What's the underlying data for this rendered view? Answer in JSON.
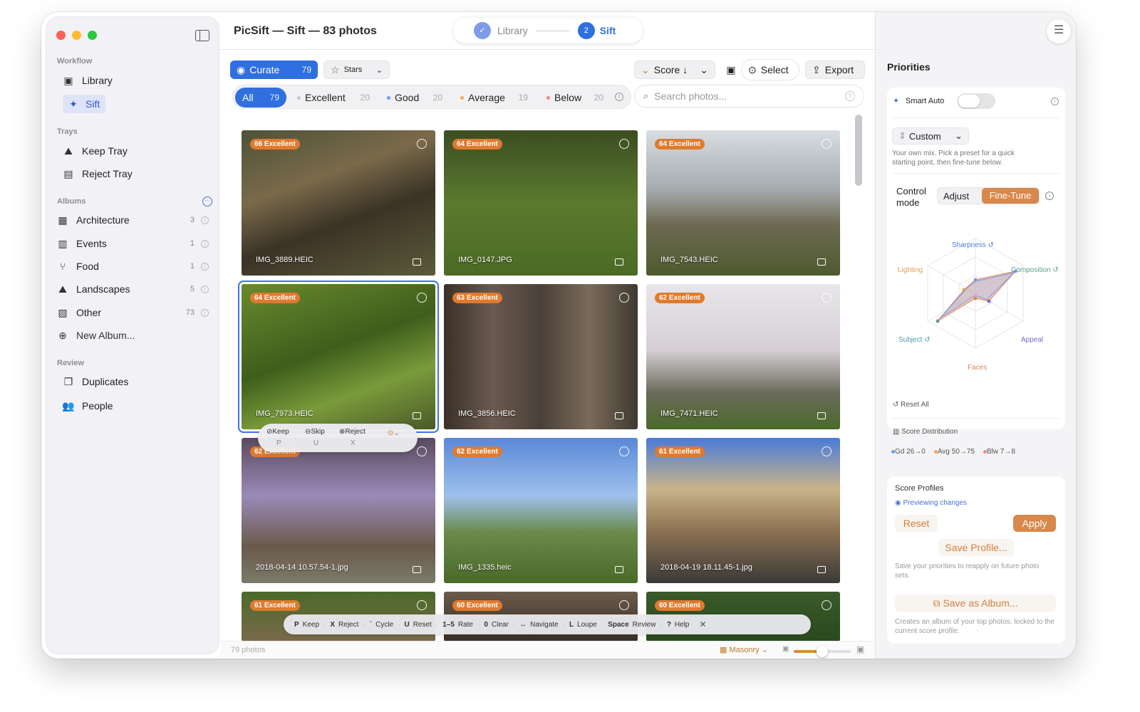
{
  "window": {
    "title": "PicSift — Sift — 83 photos"
  },
  "steps": [
    {
      "label": "Library",
      "marker": "✓"
    },
    {
      "label": "Sift",
      "marker": "2"
    }
  ],
  "sidebar": {
    "workflow_header": "Workflow",
    "library": "Library",
    "sift": "Sift",
    "trays_header": "Trays",
    "keep_tray": "Keep Tray",
    "reject_tray": "Reject Tray",
    "albums_header": "Albums",
    "albums": [
      {
        "label": "Architecture",
        "count": "3"
      },
      {
        "label": "Events",
        "count": "1"
      },
      {
        "label": "Food",
        "count": "1"
      },
      {
        "label": "Landscapes",
        "count": "5"
      },
      {
        "label": "Other",
        "count": "73"
      }
    ],
    "new_album": "New Album...",
    "review_header": "Review",
    "duplicates": "Duplicates",
    "people": "People"
  },
  "toolbar": {
    "curate_label": "Curate",
    "curate_count": "79",
    "stars_label": "Stars",
    "score_label": "Score ↓",
    "select_label": "Select",
    "export_label": "Export"
  },
  "filter_tabs": [
    {
      "label": "All",
      "count": "79"
    },
    {
      "label": "Excellent",
      "count": "20",
      "color": "#c7c7cc"
    },
    {
      "label": "Good",
      "count": "20",
      "color": "#6aa0f0"
    },
    {
      "label": "Average",
      "count": "19",
      "color": "#f0a860"
    },
    {
      "label": "Below",
      "count": "20",
      "color": "#e88a8a"
    }
  ],
  "search": {
    "placeholder": "Search photos..."
  },
  "photos": [
    {
      "badge": "66 Excellent",
      "file": "IMG_3889.HEIC"
    },
    {
      "badge": "64 Excellent",
      "file": "IMG_0147.JPG"
    },
    {
      "badge": "64 Excellent",
      "file": "IMG_7543.HEIC"
    },
    {
      "badge": "64 Excellent",
      "file": "IMG_7973.HEIC"
    },
    {
      "badge": "63 Excellent",
      "file": "IMG_3856.HEIC"
    },
    {
      "badge": "62 Excellent",
      "file": "IMG_7471.HEIC"
    },
    {
      "badge": "62 Excellent",
      "file": "2018-04-14 10.57.54-1.jpg"
    },
    {
      "badge": "62 Excellent",
      "file": "IMG_1335.heic"
    },
    {
      "badge": "61 Excellent",
      "file": "2018-04-19 18.11.45-1.jpg"
    },
    {
      "badge": "61 Excellent",
      "file": ""
    },
    {
      "badge": "60 Excellent",
      "file": ""
    },
    {
      "badge": "60 Excellent",
      "file": ""
    }
  ],
  "action_bar": {
    "keep": "Keep",
    "keep_key": "P",
    "skip": "Skip",
    "skip_key": "U",
    "reject": "Reject",
    "reject_key": "X"
  },
  "shortcuts": [
    {
      "key": "P",
      "label": "Keep"
    },
    {
      "key": "X",
      "label": "Reject"
    },
    {
      "key": "`",
      "label": "Cycle"
    },
    {
      "key": "U",
      "label": "Reset"
    },
    {
      "key": "1–5",
      "label": "Rate"
    },
    {
      "key": "0",
      "label": "Clear"
    },
    {
      "key": "↔",
      "label": "Navigate"
    },
    {
      "key": "L",
      "label": "Loupe"
    },
    {
      "key": "Space",
      "label": "Review"
    },
    {
      "key": "?",
      "label": "Help"
    }
  ],
  "footer": {
    "count": "79 photos",
    "layout": "Masonry"
  },
  "priorities": {
    "title": "Priorities",
    "smart_auto": "Smart Auto",
    "preset": "Custom",
    "preset_desc": "Your own mix. Pick a preset for a quick starting point, then fine-tune below.",
    "control_mode": "Control mode",
    "adjust": "Adjust",
    "fine_tune": "Fine-Tune",
    "radar": {
      "axes": [
        "Sharpness",
        "Composition",
        "Appeal",
        "Faces",
        "Subject",
        "Lighting"
      ]
    },
    "reset_all": "Reset All",
    "score_distribution": "Score Distribution",
    "distribution_legend": [
      {
        "label": "Gd 26→0",
        "color": "#6aa0f0"
      },
      {
        "label": "Avg 50→75",
        "color": "#f0a860"
      },
      {
        "label": "Blw 7→8",
        "color": "#e88a8a"
      }
    ],
    "profiles_title": "Score Profiles",
    "previewing": "Previewing changes",
    "reset": "Reset",
    "apply": "Apply",
    "save_profile": "Save Profile...",
    "save_profile_desc": "Save your priorities to reapply on future photo sets.",
    "save_album": "Save as Album...",
    "save_album_desc": "Creates an album of your top photos, locked to the current score profile."
  }
}
